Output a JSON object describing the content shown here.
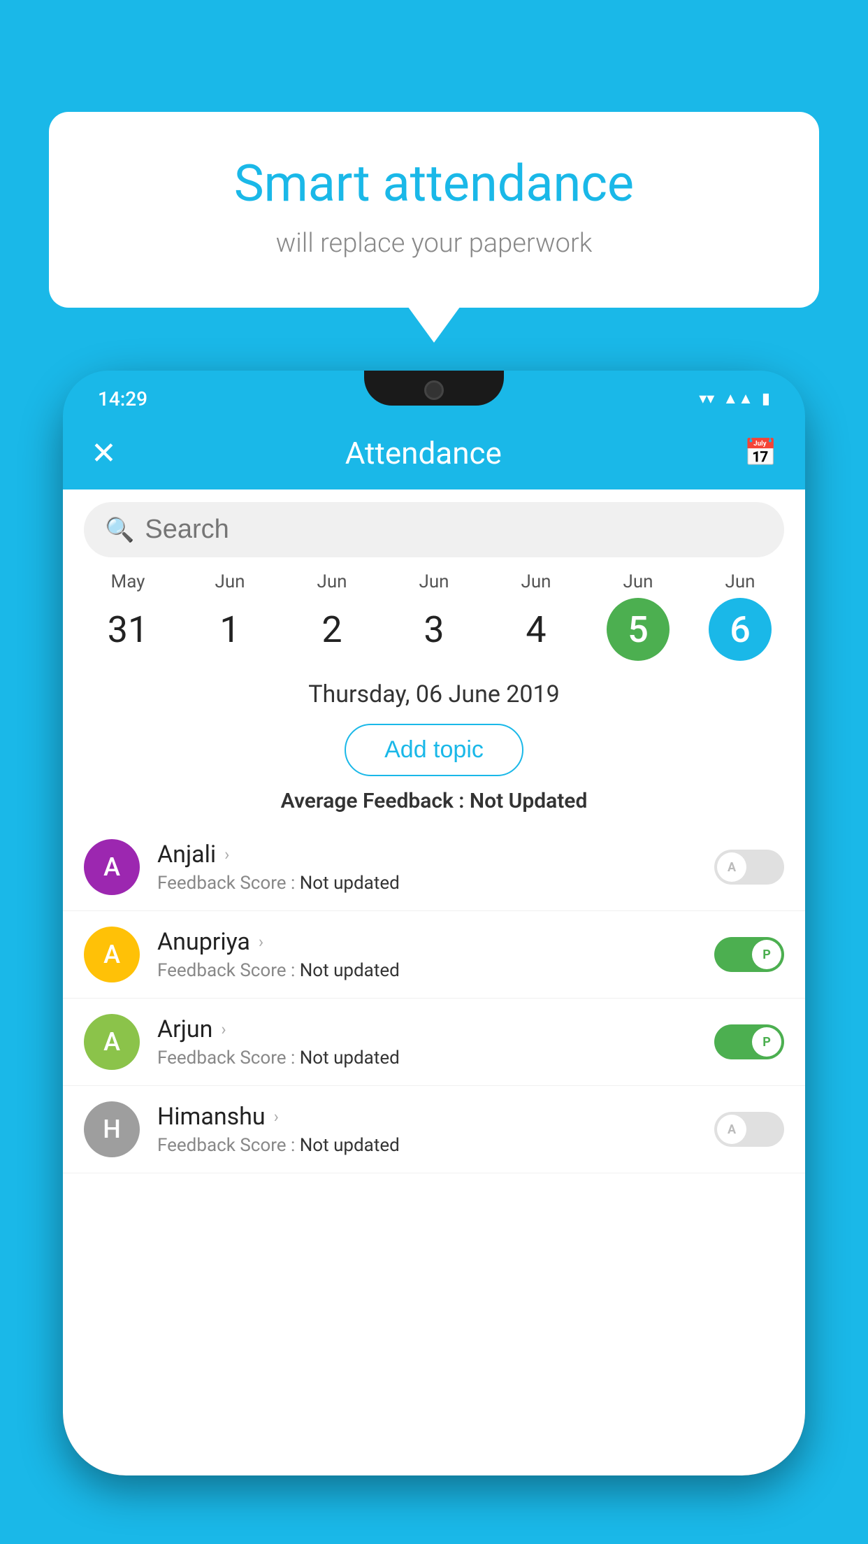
{
  "background_color": "#1ab8e8",
  "speech_bubble": {
    "title": "Smart attendance",
    "subtitle": "will replace your paperwork"
  },
  "status_bar": {
    "time": "14:29",
    "wifi_icon": "▼",
    "signal_icon": "▲",
    "battery_icon": "▮"
  },
  "app_bar": {
    "title": "Attendance",
    "close_label": "✕",
    "calendar_icon": "📅"
  },
  "search": {
    "placeholder": "Search"
  },
  "date_picker": {
    "dates": [
      {
        "month": "May",
        "day": "31",
        "state": "normal"
      },
      {
        "month": "Jun",
        "day": "1",
        "state": "normal"
      },
      {
        "month": "Jun",
        "day": "2",
        "state": "normal"
      },
      {
        "month": "Jun",
        "day": "3",
        "state": "normal"
      },
      {
        "month": "Jun",
        "day": "4",
        "state": "normal"
      },
      {
        "month": "Jun",
        "day": "5",
        "state": "today"
      },
      {
        "month": "Jun",
        "day": "6",
        "state": "selected"
      }
    ]
  },
  "selected_date": "Thursday, 06 June 2019",
  "add_topic_label": "Add topic",
  "avg_feedback_label": "Average Feedback :",
  "avg_feedback_value": "Not Updated",
  "students": [
    {
      "name": "Anjali",
      "avatar_letter": "A",
      "avatar_color": "#9c27b0",
      "feedback_label": "Feedback Score :",
      "feedback_value": "Not updated",
      "attendance": "absent",
      "toggle_letter": "A"
    },
    {
      "name": "Anupriya",
      "avatar_letter": "A",
      "avatar_color": "#ffc107",
      "feedback_label": "Feedback Score :",
      "feedback_value": "Not updated",
      "attendance": "present",
      "toggle_letter": "P"
    },
    {
      "name": "Arjun",
      "avatar_letter": "A",
      "avatar_color": "#8bc34a",
      "feedback_label": "Feedback Score :",
      "feedback_value": "Not updated",
      "attendance": "present",
      "toggle_letter": "P"
    },
    {
      "name": "Himanshu",
      "avatar_letter": "H",
      "avatar_color": "#9e9e9e",
      "feedback_label": "Feedback Score :",
      "feedback_value": "Not updated",
      "attendance": "absent",
      "toggle_letter": "A"
    }
  ]
}
